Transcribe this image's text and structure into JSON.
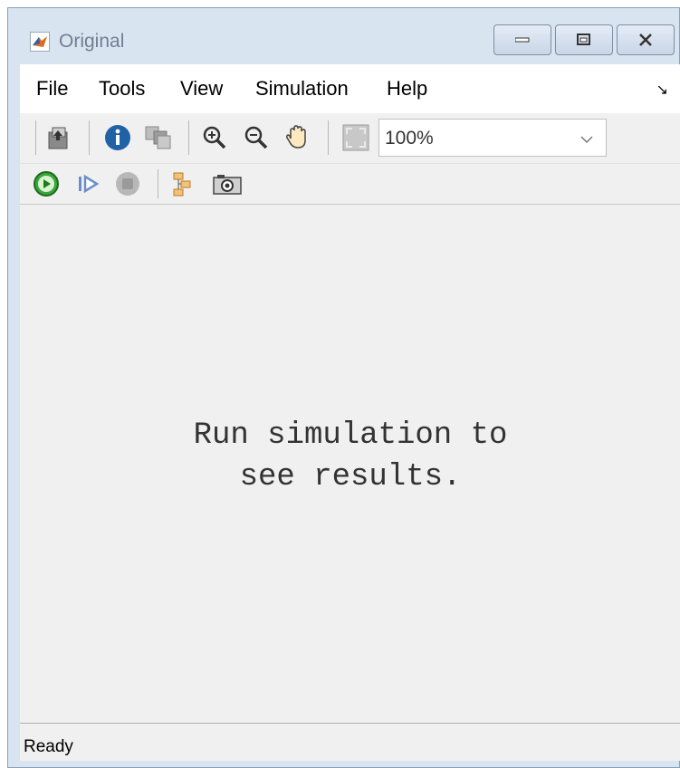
{
  "window": {
    "title": "Original"
  },
  "menu": {
    "items": [
      {
        "label": "File"
      },
      {
        "label": "Tools"
      },
      {
        "label": "View"
      },
      {
        "label": "Simulation"
      },
      {
        "label": "Help"
      }
    ],
    "corner_icon": "↘"
  },
  "toolbar": {
    "icons": [
      "up-level-icon",
      "info-icon",
      "library-icon",
      "zoom-in-icon",
      "zoom-out-icon",
      "pan-hand-icon",
      "fit-to-view-icon"
    ],
    "zoom": {
      "value": "100%"
    }
  },
  "sim_toolbar": {
    "icons": [
      "run-icon",
      "step-forward-icon",
      "stop-icon",
      "signal-hierarchy-icon",
      "snapshot-icon"
    ]
  },
  "canvas": {
    "message_line1": "Run simulation to",
    "message_line2": "see results."
  },
  "status": {
    "text": "Ready"
  },
  "colors": {
    "run_green": "#3aa63a",
    "stop_gray": "#a0a0a0",
    "info_blue": "#2161a6"
  }
}
